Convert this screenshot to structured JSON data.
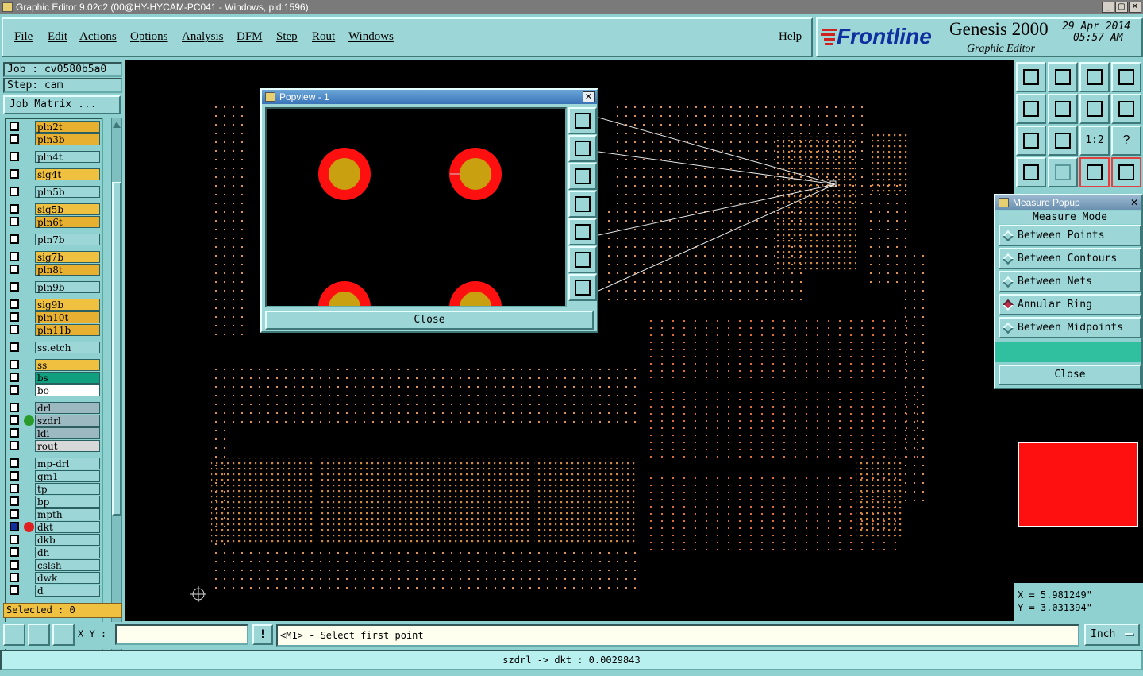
{
  "window": {
    "title": "Graphic Editor 9.02c2 (00@HY-HYCAM-PC041 - Windows, pid:1596)",
    "min": "_",
    "max": "▢",
    "close": "✕"
  },
  "menu": [
    "File",
    "Edit",
    "Actions",
    "Options",
    "Analysis",
    "DFM",
    "Step",
    "Rout",
    "Windows"
  ],
  "help": "Help",
  "brand": {
    "logo": "Frontline",
    "product": "Genesis 2000",
    "subtitle": "Graphic Editor",
    "date": "29 Apr 2014",
    "time": "05:57 AM"
  },
  "job": {
    "job_line": "Job : cv0580b5a0",
    "step_line": "Step: cam",
    "matrix_button": "Job Matrix ...",
    "selected": "Selected : 0"
  },
  "layers": [
    {
      "name": "pln2t",
      "color": "#e8b030",
      "dot": ""
    },
    {
      "name": "pln3b",
      "color": "#e8b030",
      "dot": ""
    },
    {
      "name": "pln4t",
      "color": "#9cd6d6",
      "dot": ""
    },
    {
      "name": "sig4t",
      "color": "#f0c040",
      "dot": ""
    },
    {
      "name": "pln5b",
      "color": "#9cd6d6",
      "dot": ""
    },
    {
      "name": "sig5b",
      "color": "#f0c040",
      "dot": ""
    },
    {
      "name": "pln6t",
      "color": "#e8b030",
      "dot": ""
    },
    {
      "name": "pln7b",
      "color": "#9cd6d6",
      "dot": ""
    },
    {
      "name": "sig7b",
      "color": "#f0c040",
      "dot": ""
    },
    {
      "name": "pln8t",
      "color": "#e8b030",
      "dot": ""
    },
    {
      "name": "pln9b",
      "color": "#9cd6d6",
      "dot": ""
    },
    {
      "name": "sig9b",
      "color": "#f0c040",
      "dot": ""
    },
    {
      "name": "pln10t",
      "color": "#e8b030",
      "dot": ""
    },
    {
      "name": "pln11b",
      "color": "#e8b030",
      "dot": ""
    },
    {
      "name": "ss.etch",
      "color": "#9cd6d6",
      "dot": ""
    },
    {
      "name": "ss",
      "color": "#f0c040",
      "dot": ""
    },
    {
      "name": "bs",
      "color": "#10a080",
      "dot": ""
    },
    {
      "name": "bo",
      "color": "#ffffff",
      "dot": ""
    },
    {
      "name": "drl",
      "color": "#9cb8c0",
      "dot": ""
    },
    {
      "name": "szdrl",
      "color": "#9cb8c0",
      "dot": "#2a9a2a"
    },
    {
      "name": "ldi",
      "color": "#9cb8c0",
      "dot": ""
    },
    {
      "name": "rout",
      "color": "#d8d8d8",
      "dot": ""
    },
    {
      "name": "mp-drl",
      "color": "#9cd6d6",
      "dot": ""
    },
    {
      "name": "gm1",
      "color": "#9cd6d6",
      "dot": ""
    },
    {
      "name": "tp",
      "color": "#9cd6d6",
      "dot": ""
    },
    {
      "name": "bp",
      "color": "#9cd6d6",
      "dot": ""
    },
    {
      "name": "mpth",
      "color": "#9cd6d6",
      "dot": ""
    },
    {
      "name": "dkt",
      "color": "#9cd6d6",
      "dot": "#e02020"
    },
    {
      "name": "dkb",
      "color": "#9cd6d6",
      "dot": ""
    },
    {
      "name": "dh",
      "color": "#9cd6d6",
      "dot": ""
    },
    {
      "name": "cslsh",
      "color": "#9cd6d6",
      "dot": ""
    },
    {
      "name": "dwk",
      "color": "#9cd6d6",
      "dot": ""
    },
    {
      "name": "d",
      "color": "#9cd6d6",
      "dot": ""
    }
  ],
  "popview": {
    "title": "Popview - 1",
    "close": "Close"
  },
  "measure": {
    "title": "Measure Popup",
    "mode_label": "Measure Mode",
    "options": [
      "Between Points",
      "Between Contours",
      "Between Nets",
      "Annular Ring",
      "Between Midpoints"
    ],
    "selected": "Annular Ring",
    "close": "Close"
  },
  "coords": {
    "x": "X = 5.981249\"",
    "y": "Y = 3.031394\""
  },
  "bottom": {
    "xy_label": "X Y :",
    "xy_value": "",
    "xy_icon": "!",
    "prompt": "<M1> - Select first point",
    "units": "Inch"
  },
  "status_text": "szdrl -> dkt : 0.0029843"
}
